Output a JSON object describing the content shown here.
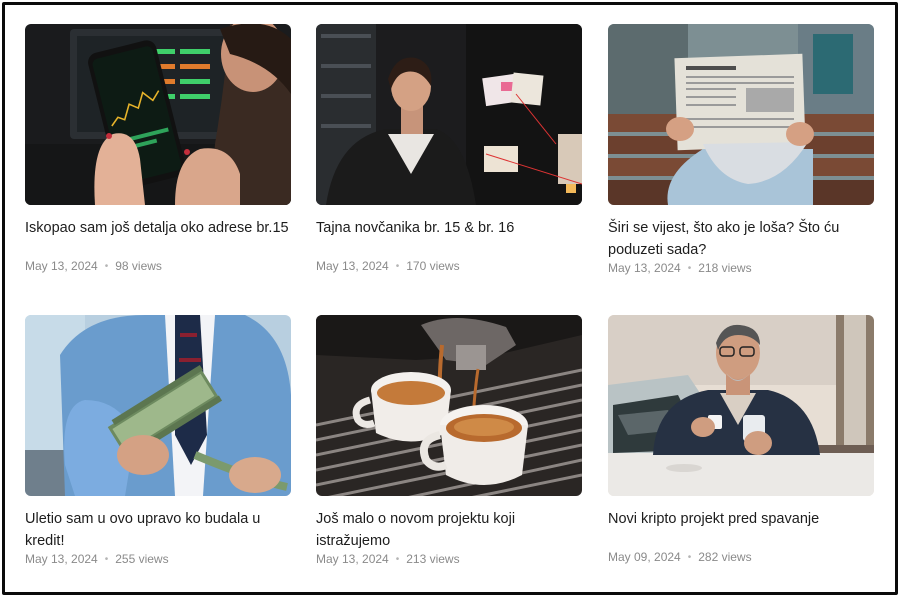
{
  "posts": [
    {
      "title": "Iskopao sam još detalja oko adrese br.15",
      "date": "May 13, 2024",
      "views": "98 views",
      "image": "trader-phone-chart"
    },
    {
      "title": "Tajna novčanika br. 15 & br. 16",
      "date": "May 13, 2024",
      "views": "170 views",
      "image": "investigator-board"
    },
    {
      "title": "Širi se vijest, što ako je loša? Što ću poduzeti sada?",
      "date": "May 13, 2024",
      "views": "218 views",
      "image": "man-reading-newspaper"
    },
    {
      "title": "Uletio sam u ovo upravo ko budala u kredit!",
      "date": "May 13, 2024",
      "views": "255 views",
      "image": "businessman-cash"
    },
    {
      "title": "Još malo o novom projektu koji istražujemo",
      "date": "May 13, 2024",
      "views": "213 views",
      "image": "espresso-machine"
    },
    {
      "title": "Novi kripto projekt pred spavanje",
      "date": "May 09, 2024",
      "views": "282 views",
      "image": "man-coffee-phone"
    }
  ],
  "colors": {
    "title": "#1d1d1d",
    "meta": "#8a8a8a",
    "border": "#0b0b0b"
  }
}
